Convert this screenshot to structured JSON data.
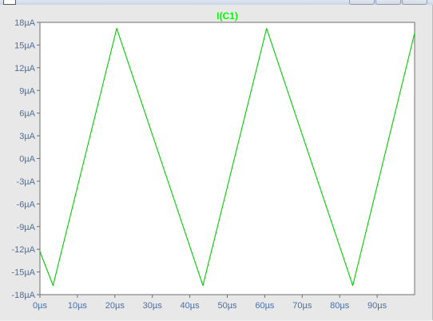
{
  "window": {
    "title_icon": "waveform-window-icon",
    "buttons": [
      "minimize",
      "maximize",
      "close"
    ]
  },
  "chart_data": {
    "type": "line",
    "title": "I(C1)",
    "title_color": "#00ff00",
    "series_color": "#00cc00",
    "axis_label_color": "#4a6fa5",
    "background": "#ffffff",
    "grid": false,
    "xlim": [
      0,
      100
    ],
    "ylim": [
      -18,
      18
    ],
    "x_ticks": [
      0,
      10,
      20,
      30,
      40,
      50,
      60,
      70,
      80,
      90
    ],
    "x_tick_labels": [
      "0µs",
      "10µs",
      "20µs",
      "30µs",
      "40µs",
      "50µs",
      "60µs",
      "70µs",
      "80µs",
      "90µs"
    ],
    "y_ticks": [
      18,
      15,
      12,
      9,
      6,
      3,
      0,
      -3,
      -6,
      -9,
      -12,
      -15,
      -18
    ],
    "y_tick_labels": [
      "18µA",
      "15µA",
      "12µA",
      "9µA",
      "6µA",
      "3µA",
      "0µA",
      "-3µA",
      "-6µA",
      "-9µA",
      "-12µA",
      "-15µA",
      "-18µA"
    ],
    "series": [
      {
        "x": [
          0,
          3.5,
          20.5,
          43.5,
          60.5,
          83.5,
          100
        ],
        "y": [
          -12.3,
          -16.8,
          17.2,
          -16.8,
          17.2,
          -16.8,
          16.6
        ]
      }
    ]
  }
}
